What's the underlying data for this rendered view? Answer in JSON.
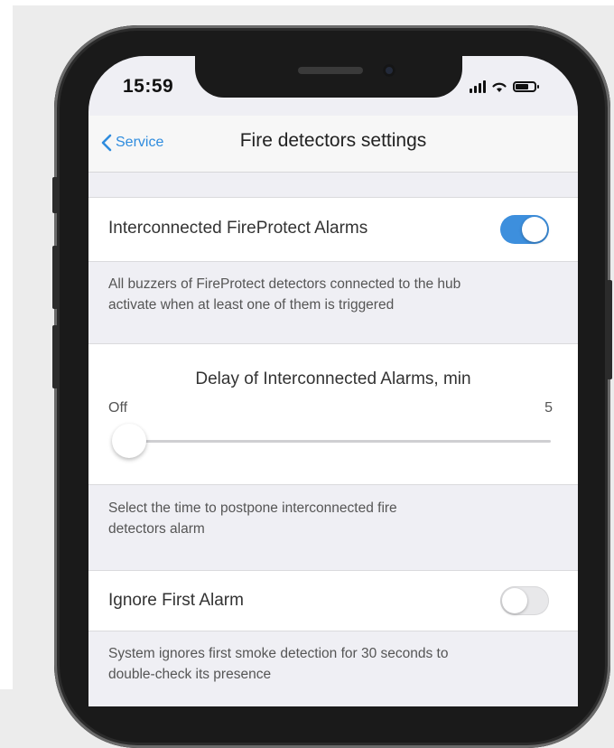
{
  "status_bar": {
    "time": "15:59"
  },
  "nav": {
    "back_label": "Service",
    "title": "Fire detectors settings"
  },
  "interconnected": {
    "label": "Interconnected FireProtect Alarms",
    "enabled": true,
    "description_line1": "All buzzers of FireProtect detectors connected to the hub",
    "description_line2": "activate when at least one of them is triggered"
  },
  "delay": {
    "title": "Delay of Interconnected Alarms, min",
    "min_label": "Off",
    "max_label": "5",
    "value": 0,
    "description_line1": "Select the time to postpone interconnected fire",
    "description_line2": "detectors alarm"
  },
  "ignore_first": {
    "label": "Ignore First Alarm",
    "enabled": false,
    "description_line1": "System ignores first smoke detection for 30 seconds to",
    "description_line2": "double-check its presence"
  },
  "colors": {
    "accent": "#3d8fdd",
    "back_link": "#2f8cde",
    "background": "#efeff4"
  },
  "icons": [
    "chevron-left-icon",
    "cellular-signal-icon",
    "wifi-icon",
    "battery-icon"
  ]
}
